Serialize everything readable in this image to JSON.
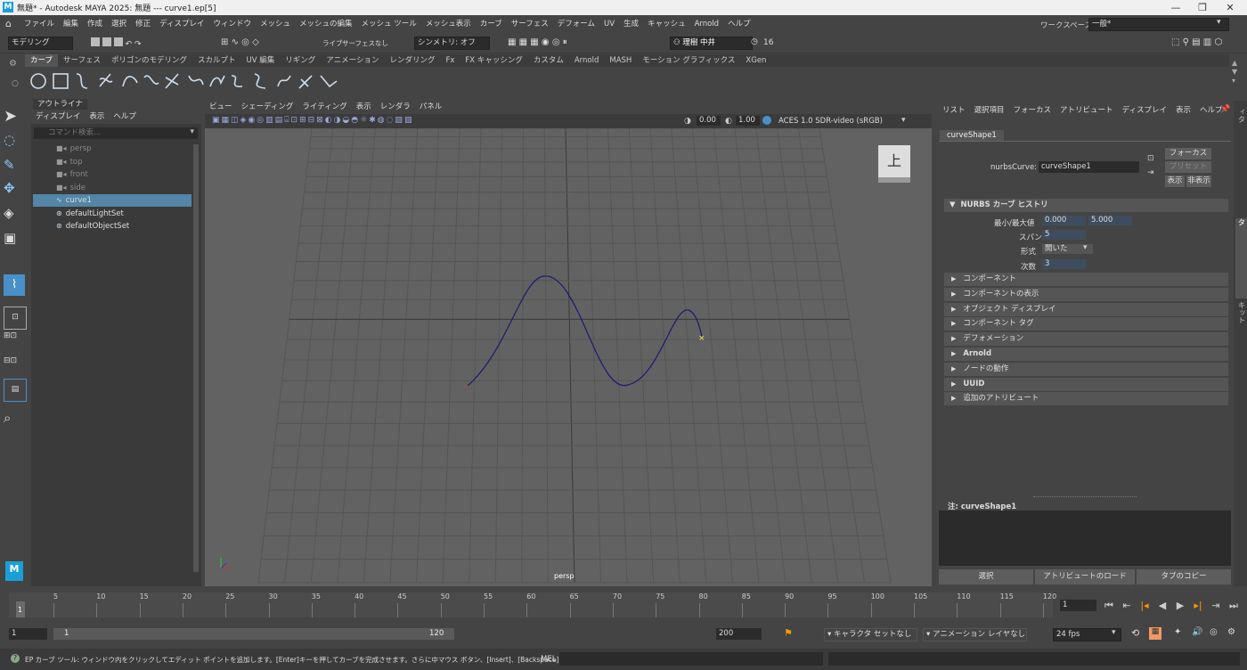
{
  "window": {
    "logo": "M",
    "title": "無題* - Autodesk MAYA 2025: 無題   ---   curve1.ep[5]",
    "min": "—",
    "max": "❐",
    "close": "✕"
  },
  "menu": [
    "ファイル",
    "編集",
    "作成",
    "選択",
    "修正",
    "ディスプレイ",
    "ウィンドウ",
    "メッシュ",
    "メッシュの編集",
    "メッシュ ツール",
    "メッシュ表示",
    "カーブ",
    "サーフェス",
    "デフォーム",
    "UV",
    "生成",
    "キャッシュ",
    "Arnold",
    "ヘルプ"
  ],
  "workspace": {
    "label": "ワークスペース :",
    "value": "一般*"
  },
  "statusline": {
    "mode": "モデリング",
    "live_label": "ライブ",
    "live_value": "サーフェスなし",
    "symmetry": "シンメトリ: オフ",
    "user": "理樹 中井",
    "count": "16"
  },
  "shelf_tabs": [
    "カーブ",
    "サーフェス",
    "ポリゴンのモデリング",
    "スカルプト",
    "UV 編集",
    "リギング",
    "アニメーション",
    "レンダリング",
    "Fx",
    "FX キャッシング",
    "カスタム",
    "Arnold",
    "MASH",
    "モーション グラフィックス",
    "XGen"
  ],
  "shelf_active": "カーブ",
  "outliner": {
    "tab": "アウトライナ",
    "menu": [
      "ディスプレイ",
      "表示",
      "ヘルプ"
    ],
    "search_placeholder": "コマンド検索...",
    "items": [
      {
        "label": "persp",
        "dim": true
      },
      {
        "label": "top",
        "dim": true
      },
      {
        "label": "front",
        "dim": true
      },
      {
        "label": "side",
        "dim": true
      },
      {
        "label": "curve1",
        "dim": false,
        "selected": true
      },
      {
        "label": "defaultLightSet",
        "dim": false
      },
      {
        "label": "defaultObjectSet",
        "dim": false
      }
    ]
  },
  "viewport": {
    "menu": [
      "ビュー",
      "シェーディング",
      "ライティング",
      "表示",
      "レンダラ",
      "パネル"
    ],
    "exposure": "0.00",
    "gamma": "1.00",
    "colorspace": "ACES 1.0 SDR-video (sRGB)",
    "camera_label": "persp",
    "viewcube": "上"
  },
  "attr": {
    "menu": [
      "リスト",
      "選択項目",
      "フォーカス",
      "アトリビュート",
      "ディスプレイ",
      "表示",
      "ヘルプ"
    ],
    "node_tab": "curveShape1",
    "node_label": "nurbsCurve:",
    "node_value": "curveShape1",
    "focus": "フォーカス",
    "preset": "プリセット",
    "show": "表示",
    "hide": "非表示",
    "history": "NURBS カーブ ヒストリ",
    "minmax_label": "最小/最大値",
    "min": "0.000",
    "max": "5.000",
    "spans_label": "スパン",
    "spans": "5",
    "form_label": "形式",
    "form": "開いた",
    "degree_label": "次数",
    "degree": "3",
    "sections": [
      "コンポーネント",
      "コンポーネントの表示",
      "オブジェクト ディスプレイ",
      "コンポーネント タグ",
      "デフォメーション",
      "Arnold",
      "ノードの動作",
      "UUID",
      "追加のアトリビュート"
    ],
    "note": "注:  curveShape1",
    "btn_select": "選択",
    "btn_load": "アトリビュートのロード",
    "btn_copy": "タブのコピー"
  },
  "sidetabs": [
    "チャネル ボックス/レイヤ エディタ",
    "アトリビュート エディタ",
    "モデリング ツールキット"
  ],
  "timeline": {
    "ticks": [
      "5",
      "10",
      "15",
      "20",
      "25",
      "30",
      "35",
      "40",
      "45",
      "50",
      "55",
      "60",
      "65",
      "70",
      "75",
      "80",
      "85",
      "90",
      "95",
      "100",
      "105",
      "110",
      "115",
      "120"
    ],
    "start": "1",
    "current": "1"
  },
  "range": {
    "start": "1",
    "inner_start": "1",
    "inner_end": "120",
    "end": "200",
    "char_set": "キャラクタ セットなし",
    "anim_layer": "アニメーション レイヤなし",
    "fps": "24 fps"
  },
  "help": {
    "text": "EP カーブ ツール: ウィンドウ内をクリックしてエディット ポイントを追加します。[Enter]キーを押してカーブを完成させます。さらに中マウス ボタン、[Insert]、[Backspace]キーを使用します。",
    "mel": "MEL"
  },
  "colors": {
    "curve": "#1a1a6e",
    "endpoint": "#f0f04a",
    "selected_row": "#5285a6",
    "accent": "#4a90c8"
  }
}
